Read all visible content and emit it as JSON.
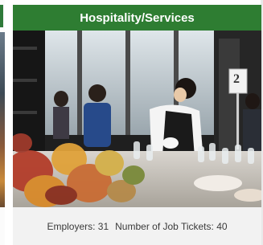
{
  "card": {
    "title": "Hospitality/Services",
    "image_description_icon": "banquet-photo",
    "table_number": "2",
    "stats": {
      "employers": "Employers: 31",
      "job_tickets": "Number of Job Tickets: 40"
    }
  },
  "colors": {
    "header_bg": "#2e7d32",
    "header_text": "#ffffff",
    "card_bg": "#f0f0f0"
  }
}
